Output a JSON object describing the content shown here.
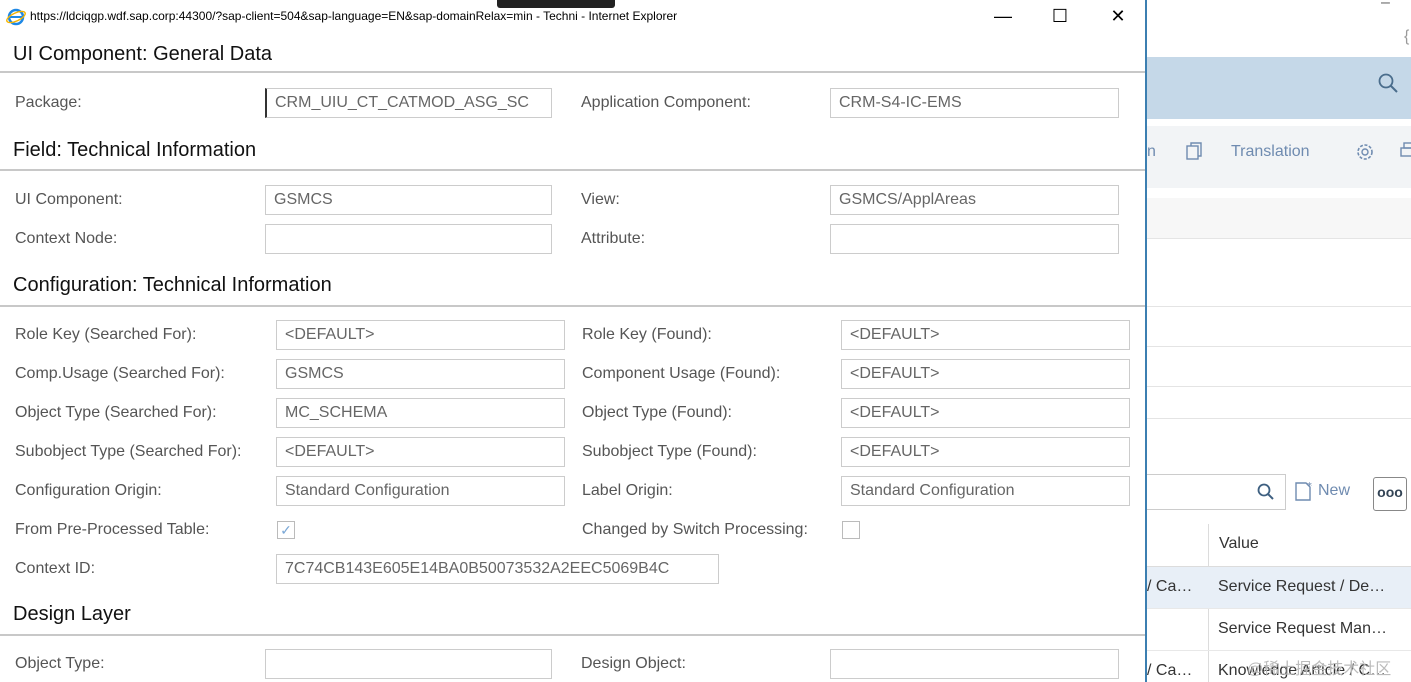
{
  "window": {
    "title": "https://ldciqgp.wdf.sap.corp:44300/?sap-client=504&sap-language=EN&sap-domainRelax=min - Techni - Internet Explorer",
    "minimize": "—",
    "maximize": "☐",
    "close": "✕"
  },
  "sections": {
    "general": "UI Component: General Data",
    "field_tech": "Field: Technical Information",
    "config_tech": "Configuration: Technical Information",
    "design": "Design Layer"
  },
  "general": {
    "package_label": "Package:",
    "package_value": "CRM_UIU_CT_CATMOD_ASG_SC",
    "appcomp_label": "Application Component:",
    "appcomp_value": "CRM-S4-IC-EMS"
  },
  "field_tech": {
    "uicomp_label": "UI Component:",
    "uicomp_value": "GSMCS",
    "view_label": "View:",
    "view_value": "GSMCS/ApplAreas",
    "ctxnode_label": "Context Node:",
    "ctxnode_value": "",
    "attr_label": "Attribute:",
    "attr_value": ""
  },
  "config_tech": {
    "rolekey_s_label": "Role Key (Searched For):",
    "rolekey_s_value": "<DEFAULT>",
    "rolekey_f_label": "Role Key (Found):",
    "rolekey_f_value": "<DEFAULT>",
    "compusage_s_label": "Comp.Usage (Searched For):",
    "compusage_s_value": "GSMCS",
    "compusage_f_label": "Component Usage (Found):",
    "compusage_f_value": "<DEFAULT>",
    "objtype_s_label": "Object Type (Searched For):",
    "objtype_s_value": "MC_SCHEMA",
    "objtype_f_label": "Object Type (Found):",
    "objtype_f_value": "<DEFAULT>",
    "subobj_s_label": "Subobject Type (Searched For):",
    "subobj_s_value": "<DEFAULT>",
    "subobj_f_label": "Subobject Type (Found):",
    "subobj_f_value": "<DEFAULT>",
    "cfgorigin_label": "Configuration Origin:",
    "cfgorigin_value": "Standard Configuration",
    "lblorigin_label": "Label Origin:",
    "lblorigin_value": "Standard Configuration",
    "preproc_label": "From Pre-Processed Table:",
    "preproc_checked": true,
    "switch_label": "Changed by Switch Processing:",
    "switch_checked": false,
    "ctxid_label": "Context ID:",
    "ctxid_value": "7C74CB143E605E14BA0B50073532A2EEC5069B4C"
  },
  "design": {
    "objtype_label": "Object Type:",
    "objtype_value": "",
    "designobj_label": "Design Object:",
    "designobj_value": ""
  },
  "background": {
    "toolbar_partial": "n",
    "translation": "Translation",
    "new_label": "New",
    "more_label": "ooo",
    "value_header": "Value",
    "rows": [
      {
        "left": "/ Ca…",
        "value": "Service Request / De…"
      },
      {
        "left": "",
        "value": "Service Request Man…"
      },
      {
        "left": "/ Ca…",
        "value": "Knowledge Article / C…"
      }
    ],
    "watermark": "@稀土掘金技术社区"
  },
  "colors": {
    "accent": "#3c7fb1",
    "shell": "#c5d8e8",
    "link": "#6f8bb0"
  }
}
